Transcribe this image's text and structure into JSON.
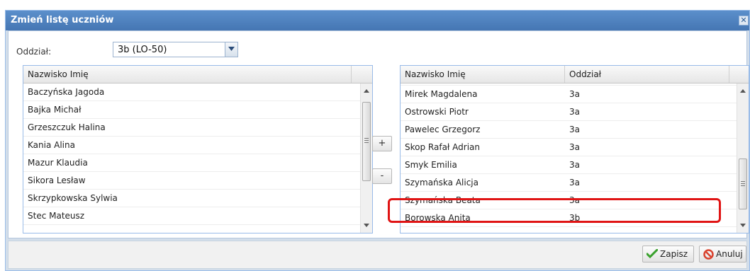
{
  "dialog": {
    "title": "Zmień listę uczniów",
    "close_glyph": "✕"
  },
  "filter": {
    "label": "Oddział:",
    "selected": "3b (LO-50)"
  },
  "left_grid": {
    "columns": [
      "Nazwisko Imię"
    ],
    "rows": [
      "Baczyńska Jagoda",
      "Bajka Michał",
      "Grzeszczuk Halina",
      "Kania Alina",
      "Mazur Klaudia",
      "Sikora Lesław",
      "Skrzypkowska Sylwia",
      "Stec Mateusz"
    ]
  },
  "buttons": {
    "add": "+",
    "remove": "-",
    "save": "Zapisz",
    "cancel": "Anuluj"
  },
  "right_grid": {
    "columns": [
      "Nazwisko Imię",
      "Oddział"
    ],
    "rows": [
      {
        "name": "Mirek Magdalena",
        "class": "3a"
      },
      {
        "name": "Ostrowski Piotr",
        "class": "3a"
      },
      {
        "name": "Pawelec Grzegorz",
        "class": "3a"
      },
      {
        "name": "Skop Rafał Adrian",
        "class": "3a"
      },
      {
        "name": "Smyk Emilia",
        "class": "3a"
      },
      {
        "name": "Szymańska Alicja",
        "class": "3a"
      },
      {
        "name": "Szymańska Beata",
        "class": "3a"
      },
      {
        "name": "Borowska Anita",
        "class": "3b"
      }
    ],
    "highlighted_row": "Szymańska Beata"
  },
  "icons": {
    "save": "checkmark-icon",
    "cancel": "cancel-icon",
    "combo": "chevron-down-icon"
  },
  "colors": {
    "title_bar": "#4f82c0",
    "highlight": "#e01414",
    "save_icon": "#3aa12d",
    "cancel_icon": "#d9432f"
  }
}
